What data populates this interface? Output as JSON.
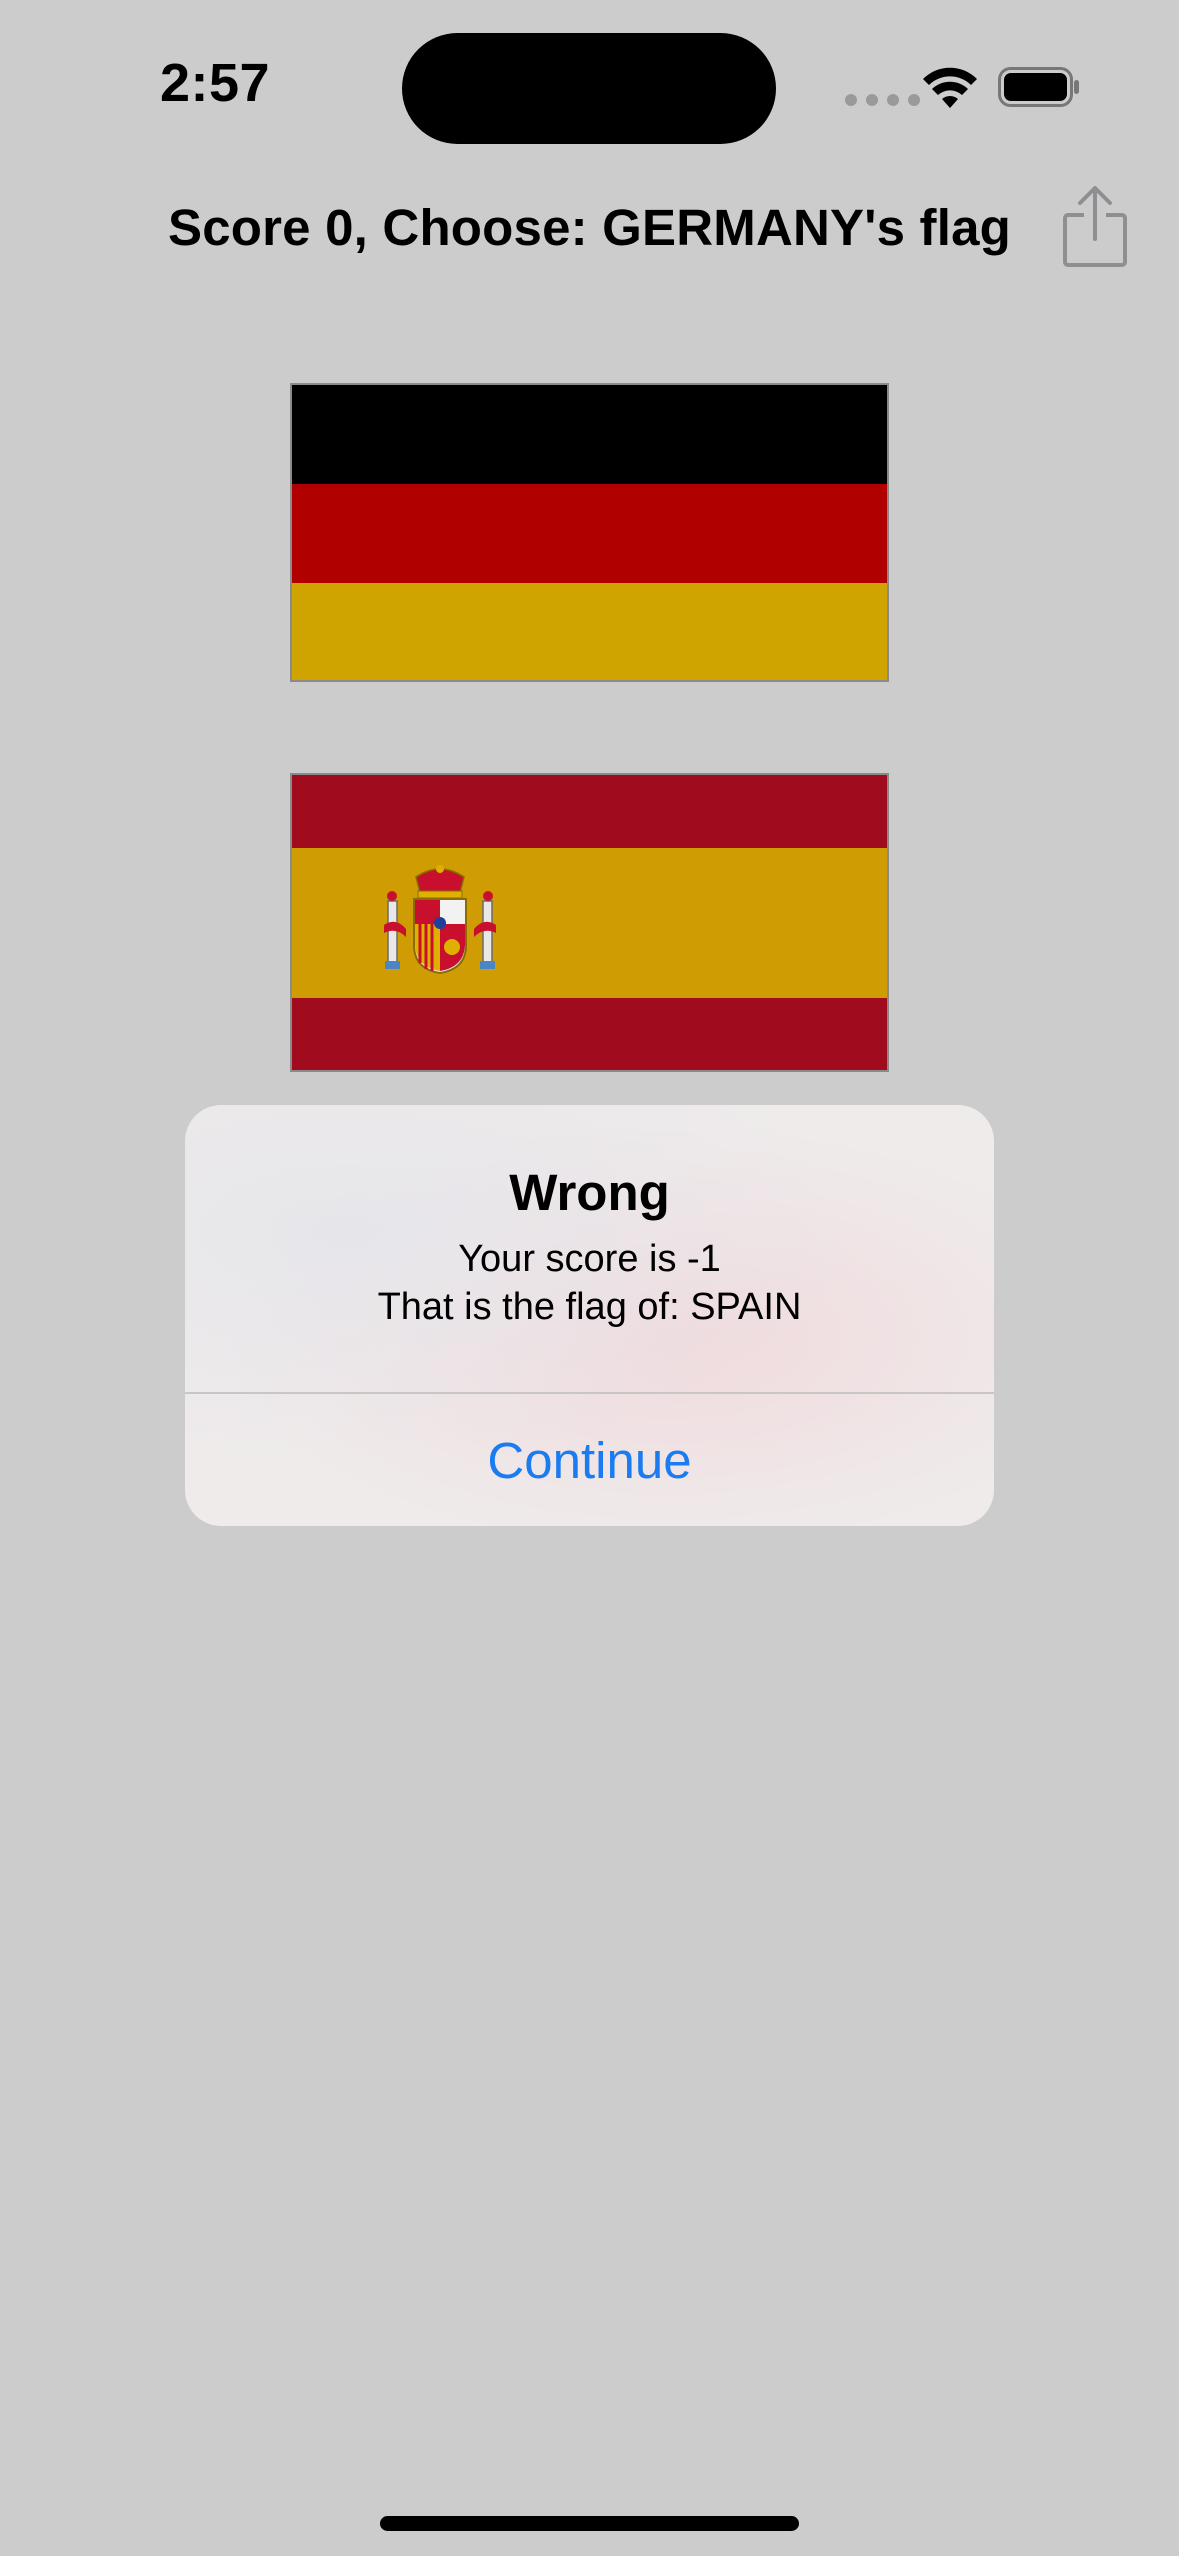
{
  "status_bar": {
    "time": "2:57",
    "icons": [
      "cellular-signal-icon",
      "wifi-icon",
      "battery-icon"
    ]
  },
  "nav": {
    "title": "Score 0, Choose: GERMANY's flag",
    "share_icon": "share-icon"
  },
  "flags": [
    {
      "country": "Germany",
      "colors": [
        "#000000",
        "#b00000",
        "#d0a400"
      ]
    },
    {
      "country": "Spain",
      "colors": [
        "#a00c1e",
        "#cf9d03",
        "#a00c1e"
      ]
    }
  ],
  "alert": {
    "title": "Wrong",
    "message_line1": "Your score is -1",
    "message_line2": "That is the flag of: SPAIN",
    "button_label": "Continue",
    "button_color": "#1a7cf0"
  },
  "colors": {
    "background": "#cccccc"
  }
}
